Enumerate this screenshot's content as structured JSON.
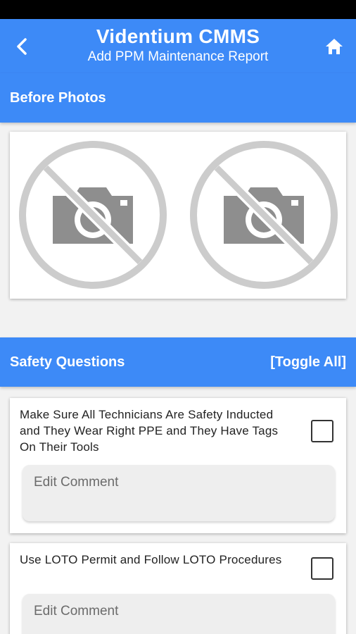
{
  "app_bar": {
    "title": "Videntium CMMS",
    "subtitle": "Add PPM Maintenance Report",
    "back_icon": "chevron-left-icon",
    "home_icon": "home-icon",
    "color": "#3d8af7"
  },
  "before_photos": {
    "title": "Before Photos",
    "slots": [
      {
        "icon": "no-photo-icon"
      },
      {
        "icon": "no-photo-icon"
      }
    ]
  },
  "safety": {
    "title": "Safety Questions",
    "toggle_label": "[Toggle All]",
    "questions": [
      {
        "text": "Make Sure All Technicians Are Safety Inducted and They Wear Right PPE and They Have Tags On Their Tools",
        "checked": false,
        "comment_placeholder": "Edit Comment"
      },
      {
        "text": "Use LOTO Permit and Follow LOTO Procedures",
        "checked": false,
        "comment_placeholder": "Edit Comment"
      }
    ]
  }
}
